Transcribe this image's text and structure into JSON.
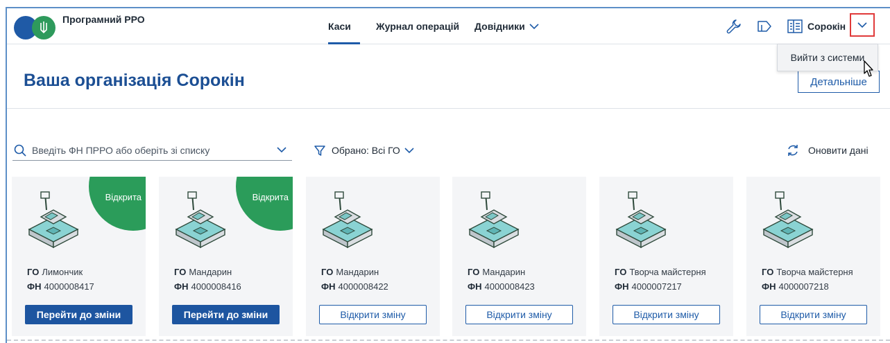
{
  "header": {
    "logo_text": "Програмний РРО",
    "nav": [
      {
        "label": "Каси"
      },
      {
        "label": "Журнал операцій"
      },
      {
        "label": "Довідники"
      }
    ],
    "user_name": "Сорокін",
    "dropdown_item": "Вийти з системи"
  },
  "org": {
    "title": "Ваша організація Сорокін",
    "details_label": "Детальніше"
  },
  "filters": {
    "search_placeholder": "Введіть ФН ПРРО або оберіть зі списку",
    "selected": "Обрано: Всі ГО",
    "refresh_label": "Оновити дані"
  },
  "labels": {
    "go": "ГО",
    "fn": "ФН"
  },
  "cards": [
    {
      "go": "Лимончик",
      "fn": "4000008417",
      "status": "Відкрита",
      "button": "Перейти до зміни"
    },
    {
      "go": "Мандарин",
      "fn": "4000008416",
      "status": "Відкрита",
      "button": "Перейти до зміни"
    },
    {
      "go": "Мандарин",
      "fn": "4000008422",
      "status": "",
      "button": "Відкрити зміну"
    },
    {
      "go": "Мандарин",
      "fn": "4000008423",
      "status": "",
      "button": "Відкрити зміну"
    },
    {
      "go": "Творча майстерня",
      "fn": "4000007217",
      "status": "",
      "button": "Відкрити зміну"
    },
    {
      "go": "Творча майстерня",
      "fn": "4000007218",
      "status": "",
      "button": "Відкрити зміну"
    }
  ],
  "colors": {
    "primary": "#1d55a0",
    "open_badge": "#2b9c5a",
    "highlight": "#e03a3a"
  }
}
